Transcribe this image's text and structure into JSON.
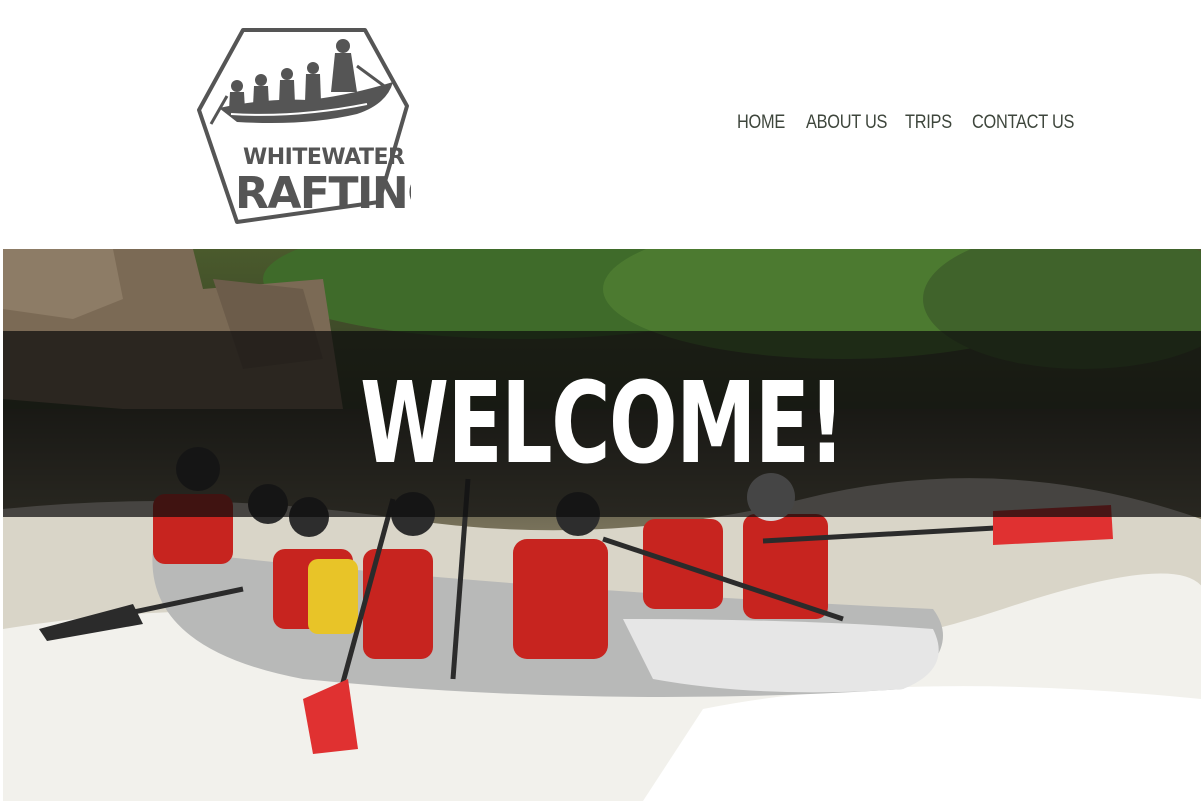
{
  "logo": {
    "line1": "WHITEWATER",
    "line2": "RAFTING",
    "icon": "raft-icon",
    "color": "#555555"
  },
  "nav": {
    "items": [
      {
        "label": "HOME"
      },
      {
        "label": "ABOUT US"
      },
      {
        "label": "TRIPS"
      },
      {
        "label": "CONTACT US"
      }
    ],
    "color": "#3e463c"
  },
  "hero": {
    "heading": "WELCOME!",
    "image": "whitewater-rafting-photo",
    "overlay_color": "#0c0c0c"
  }
}
